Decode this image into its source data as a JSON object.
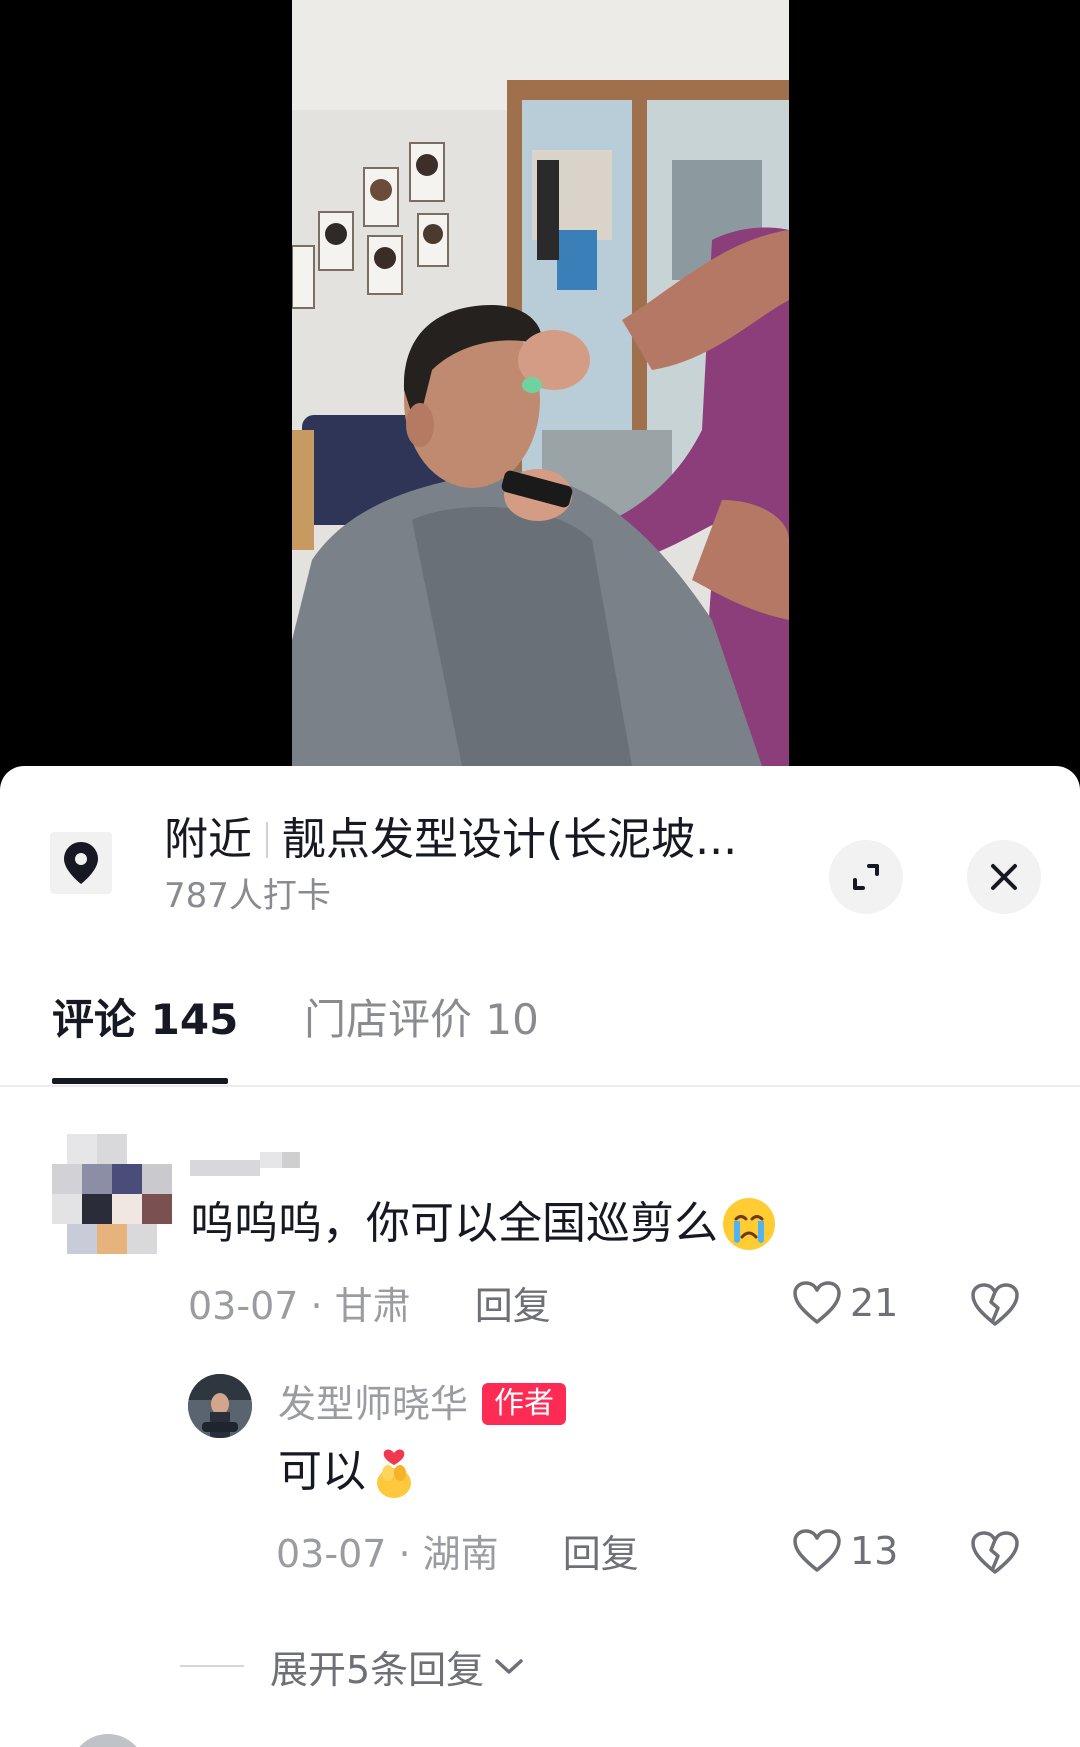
{
  "poi": {
    "category": "附近",
    "name": "靓点发型设计(长泥坡...",
    "checkins": "787人打卡",
    "pin_icon": "location-pin-icon",
    "expand_icon": "expand-icon",
    "close_icon": "close-icon"
  },
  "tabs": [
    {
      "label": "评论 145",
      "active": true
    },
    {
      "label": "门店评价 10",
      "active": false
    }
  ],
  "comments": [
    {
      "text": "呜呜呜，你可以全国巡剪么",
      "emoji": "crying-face-emoji",
      "date": "03-07",
      "location": "· 甘肃",
      "reply_label": "回复",
      "likes": "21"
    }
  ],
  "reply": {
    "author": "发型师晓华",
    "badge": "作者",
    "text": "可以",
    "emoji": "finger-heart-emoji",
    "date": "03-07",
    "location": "· 湖南",
    "reply_label": "回复",
    "likes": "13"
  },
  "expand_replies": "展开5条回复",
  "colors": {
    "accent": "#fe2c55",
    "text_primary": "#161823",
    "text_secondary": "#8a8b91"
  }
}
